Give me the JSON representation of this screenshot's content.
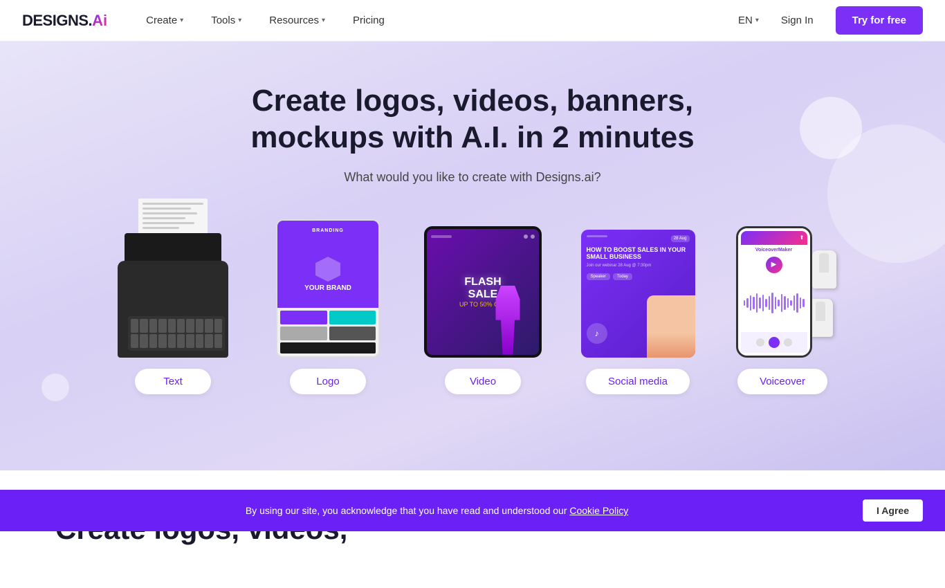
{
  "brand": {
    "name": "DESIGNS.",
    "ai": "Ai",
    "logo_label": "Designs.ai logo"
  },
  "navbar": {
    "create_label": "Create",
    "tools_label": "Tools",
    "resources_label": "Resources",
    "pricing_label": "Pricing",
    "lang_label": "EN",
    "sign_in_label": "Sign In",
    "try_free_label": "Try for free"
  },
  "hero": {
    "title": "Create logos, videos, banners, mockups with A.I. in 2 minutes",
    "subtitle": "What would you like to create with Designs.ai?",
    "cards": [
      {
        "id": "text",
        "label": "Text"
      },
      {
        "id": "logo",
        "label": "Logo"
      },
      {
        "id": "video",
        "label": "Video"
      },
      {
        "id": "social-media",
        "label": "Social media"
      },
      {
        "id": "voiceover",
        "label": "Voiceover"
      }
    ]
  },
  "below_hero": {
    "title": "Create logos, videos,"
  },
  "cookie": {
    "text": "By using our site, you acknowledge that you have read and understood our",
    "link_text": "Cookie Policy",
    "agree_label": "I Agree"
  },
  "wave_heights": [
    8,
    14,
    22,
    18,
    28,
    16,
    24,
    12,
    20,
    30,
    18,
    10,
    26,
    20,
    14,
    8,
    22,
    28,
    16,
    12
  ],
  "grid_colors": [
    "#7b2ff7",
    "#00c9c8",
    "#333",
    "#555",
    "#888",
    "#aaa",
    "#1a1a1a",
    "#ddd"
  ],
  "colors": {
    "primary": "#7b2ff7",
    "accent": "#f72f8d",
    "dark": "#1a1a2e",
    "cookie_bg": "#6b21f5"
  }
}
